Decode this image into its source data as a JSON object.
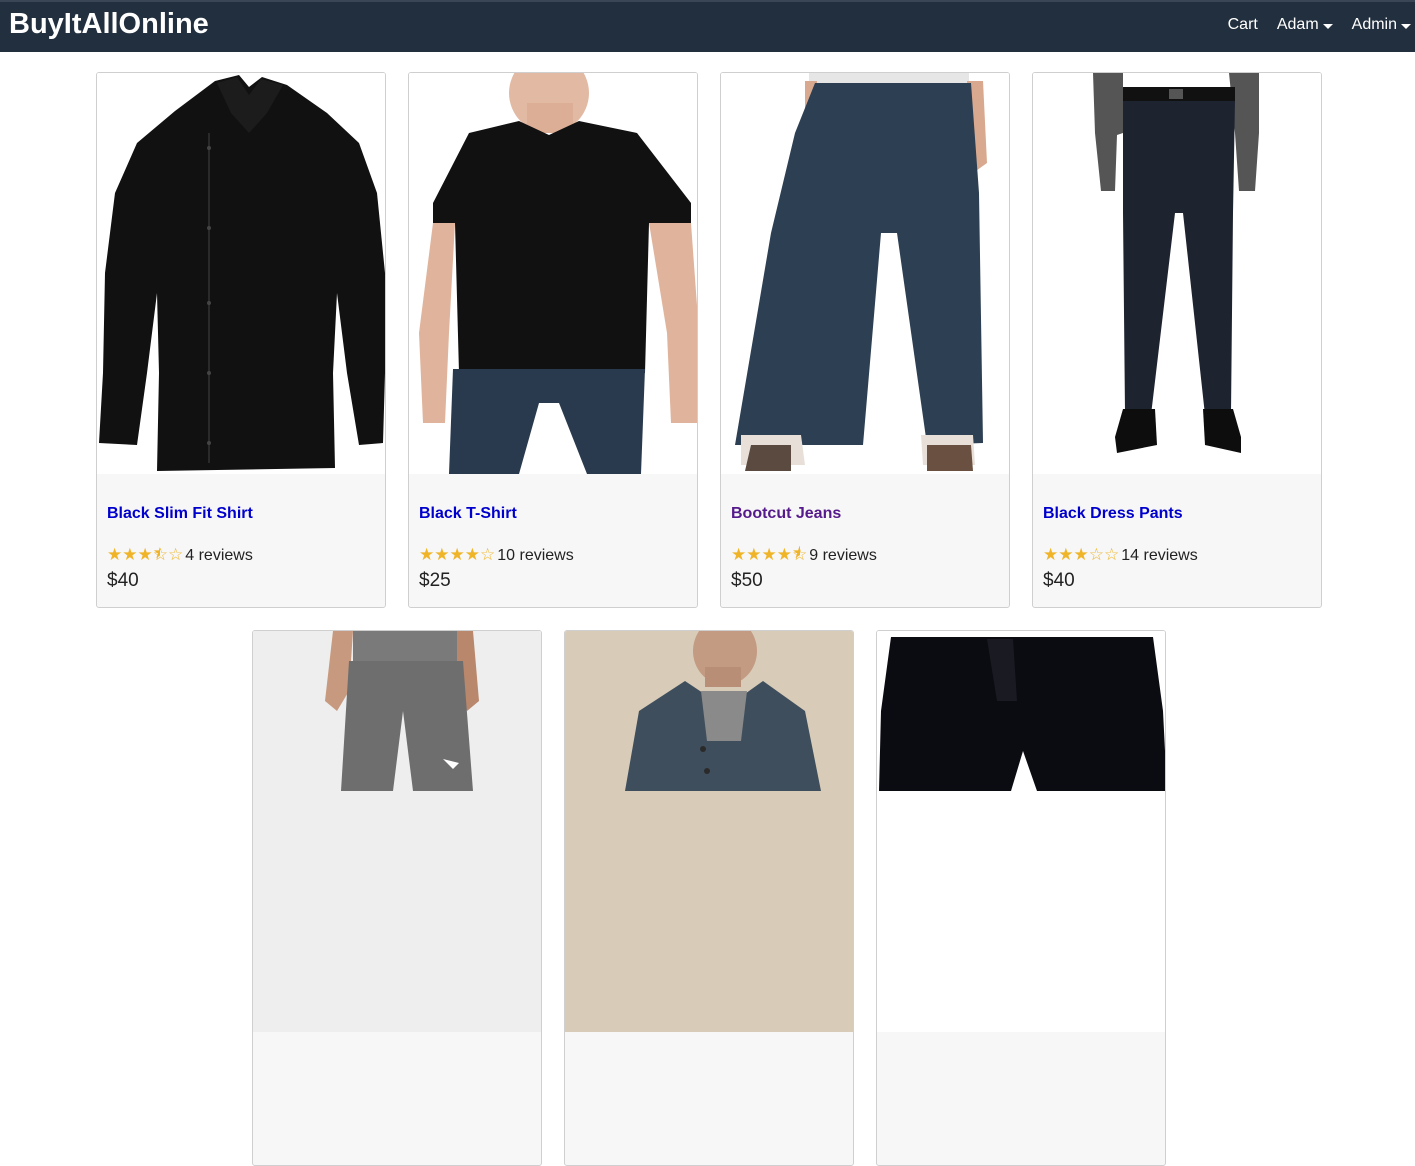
{
  "navbar": {
    "brand": "BuyItAllOnline",
    "cart": "Cart",
    "user": "Adam",
    "admin": "Admin"
  },
  "products": [
    {
      "name": "Black Slim Fit Shirt",
      "rating": 3.5,
      "reviews": "4 reviews",
      "price": "$40",
      "link_color": "#0000cc"
    },
    {
      "name": "Black T-Shirt",
      "rating": 4,
      "reviews": "10 reviews",
      "price": "$25",
      "link_color": "#0000cc"
    },
    {
      "name": "Bootcut Jeans",
      "rating": 4.5,
      "reviews": "9 reviews",
      "price": "$50",
      "link_color": "#551a8b"
    },
    {
      "name": "Black Dress Pants",
      "rating": 3,
      "reviews": "14 reviews",
      "price": "$40",
      "link_color": "#0000cc"
    },
    {
      "name": "",
      "rating": null,
      "reviews": "",
      "price": "",
      "link_color": "#0000cc"
    },
    {
      "name": "",
      "rating": null,
      "reviews": "",
      "price": "",
      "link_color": "#0000cc"
    },
    {
      "name": "",
      "rating": null,
      "reviews": "",
      "price": "",
      "link_color": "#0000cc"
    }
  ],
  "colors": {
    "navbar_bg": "#222f3e",
    "star": "#f0b429",
    "card_footer_bg": "#f7f7f7"
  }
}
